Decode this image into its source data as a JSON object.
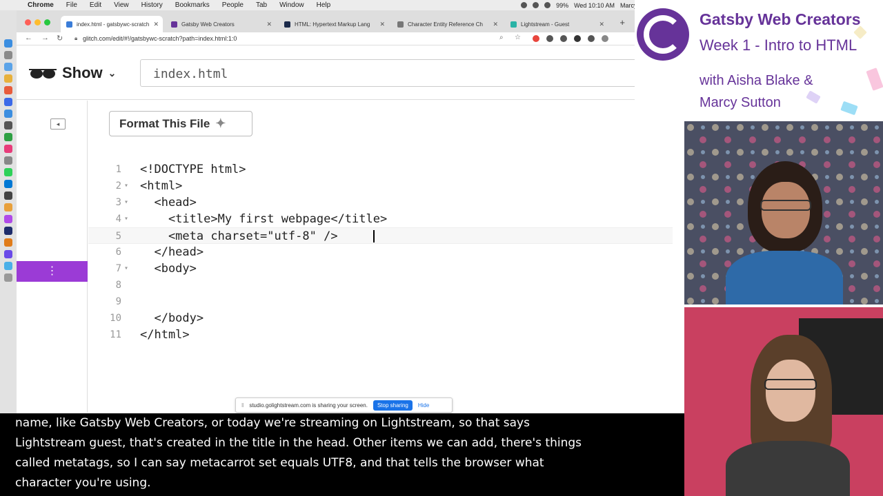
{
  "menubar": {
    "app": "Chrome",
    "items": [
      "File",
      "Edit",
      "View",
      "History",
      "Bookmarks",
      "People",
      "Tab",
      "Window",
      "Help"
    ],
    "battery": "99%",
    "clock": "Wed 10:10 AM",
    "user": "Marcy Sutton"
  },
  "browser": {
    "tabs": [
      {
        "label": "index.html - gatsbywc-scratch",
        "color": "#3b7dd8"
      },
      {
        "label": "Gatsby Web Creators",
        "color": "#663399"
      },
      {
        "label": "HTML: Hypertext Markup Lang",
        "color": "#1b2a4a"
      },
      {
        "label": "Character Entity Reference Ch",
        "color": "#777777"
      },
      {
        "label": "Lightstream - Guest",
        "color": "#2ab3a6"
      }
    ],
    "url": "glitch.com/edit/#!/gatsbywc-scratch?path=index.html:1:0"
  },
  "glitch": {
    "show_label": "Show",
    "filename": "index.html",
    "format_label": "Format This File"
  },
  "editor": {
    "lines": [
      {
        "n": "1",
        "fold": "",
        "text": "<!DOCTYPE html>"
      },
      {
        "n": "2",
        "fold": "▾",
        "text": "<html>"
      },
      {
        "n": "3",
        "fold": "▾",
        "text": "  <head>"
      },
      {
        "n": "4",
        "fold": "▾",
        "text": "    <title>My first webpage</title>"
      },
      {
        "n": "5",
        "fold": "",
        "text": "    <meta charset=\"utf-8\" />"
      },
      {
        "n": "6",
        "fold": "",
        "text": "  </head>"
      },
      {
        "n": "7",
        "fold": "▾",
        "text": "  <body>"
      },
      {
        "n": "8",
        "fold": "",
        "text": ""
      },
      {
        "n": "9",
        "fold": "",
        "text": ""
      },
      {
        "n": "10",
        "fold": "",
        "text": "  </body>"
      },
      {
        "n": "11",
        "fold": "",
        "text": "</html>"
      }
    ]
  },
  "sharing": {
    "message": "studio.golightstream.com is sharing your screen.",
    "stop": "Stop sharing",
    "hide": "Hide"
  },
  "caption": {
    "lines": [
      "name, like Gatsby Web Creators, or today we're streaming on Lightstream, so that says",
      "Lightstream guest, that's created in the title in the head. Other items we can add, there's things",
      "called metatags, so I can say metacarrot set equals UTF8, and that tells the browser what",
      "character you're using."
    ]
  },
  "brand": {
    "title": "Gatsby Web Creators",
    "subtitle": "Week 1 - Intro to HTML",
    "with_line1": "with Aisha Blake &",
    "with_line2": "Marcy Sutton",
    "accent": "#663399"
  }
}
